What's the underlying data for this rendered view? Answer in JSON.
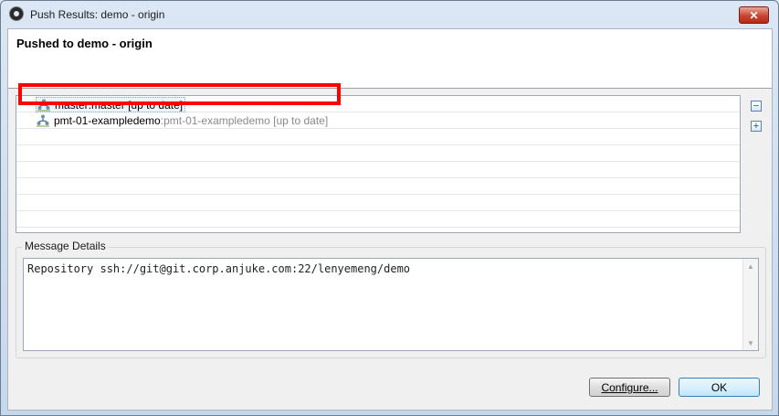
{
  "window": {
    "title": "Push Results: demo - origin",
    "close_label": "✕"
  },
  "header": {
    "title": "Pushed to demo - origin"
  },
  "refs": [
    {
      "local": "master",
      "remote": "master",
      "status": "[up to date]",
      "selected": true
    },
    {
      "local": "pmt-01-exampledemo",
      "remote": "pmt-01-exampledemo",
      "status": "[up to date]",
      "selected": false,
      "highlighted": true
    }
  ],
  "tree_controls": {
    "collapse_label": "−",
    "expand_label": "+"
  },
  "message_details": {
    "label": "Message Details",
    "text": "Repository ssh://git@git.corp.anjuke.com:22/lenyemeng/demo"
  },
  "buttons": {
    "configure": "Configure...",
    "ok": "OK"
  },
  "colors": {
    "highlight_border": "#ff0000",
    "remote_ref_text": "#8a8a8a"
  }
}
